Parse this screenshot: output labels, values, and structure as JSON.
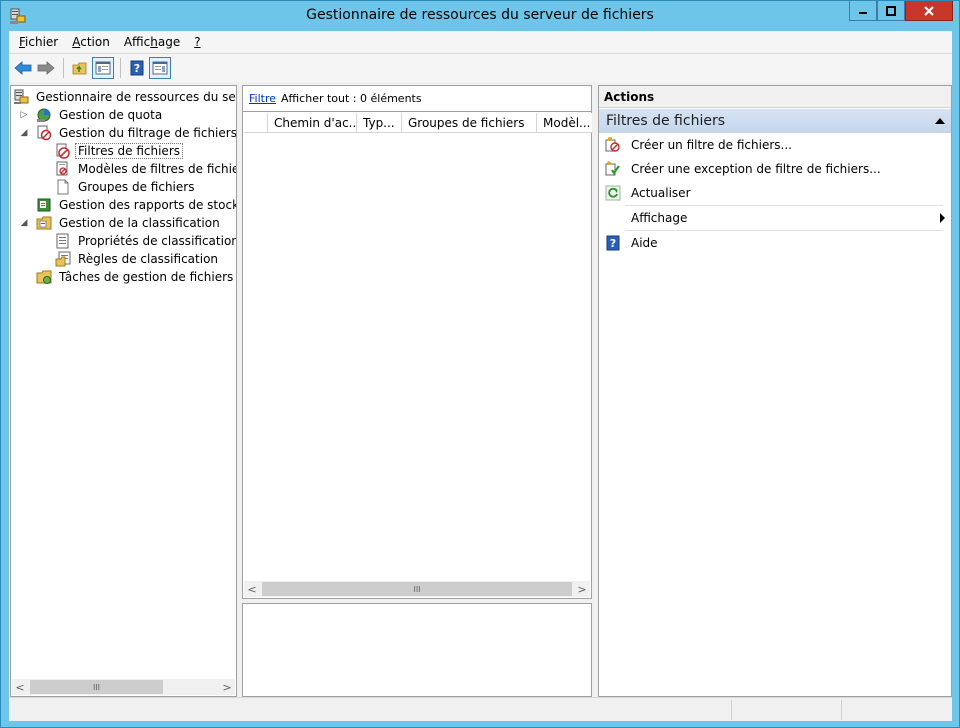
{
  "window": {
    "title": "Gestionnaire de ressources du serveur de fichiers",
    "controls": {
      "minimize": "minimize",
      "maximize": "maximize",
      "close": "close"
    }
  },
  "menu": [
    {
      "label": "Fichier",
      "accel": "F",
      "rest": "ichier"
    },
    {
      "label": "Action",
      "accel": "A",
      "rest": "ction"
    },
    {
      "label": "Affichage",
      "pre": "Affic",
      "accel": "h",
      "rest": "age"
    },
    {
      "label": "?",
      "accel": "?",
      "rest": ""
    }
  ],
  "toolbar": {
    "icons": [
      "back-arrow-icon",
      "forward-arrow-icon",
      "up-folder-icon",
      "show-hide-tree-icon",
      "help-icon",
      "show-hide-actions-icon"
    ]
  },
  "tree": {
    "items": [
      {
        "label": "Gestionnaire de ressources du serveur",
        "level": 0,
        "expander": "",
        "icon": "server-icon"
      },
      {
        "label": "Gestion de quota",
        "level": 1,
        "expander": "▷",
        "icon": "quota-icon"
      },
      {
        "label": "Gestion du filtrage de fichiers",
        "level": 1,
        "expander": "◢",
        "icon": "file-screening-icon"
      },
      {
        "label": "Filtres de fichiers",
        "level": 2,
        "expander": "",
        "icon": "file-screen-icon",
        "selected": true
      },
      {
        "label": "Modèles de filtres de fichiers",
        "level": 2,
        "expander": "",
        "icon": "file-screen-template-icon"
      },
      {
        "label": "Groupes de fichiers",
        "level": 2,
        "expander": "",
        "icon": "file-group-icon"
      },
      {
        "label": "Gestion des rapports de stockage",
        "level": 1,
        "expander": "",
        "icon": "storage-report-icon"
      },
      {
        "label": "Gestion de la classification",
        "level": 1,
        "expander": "◢",
        "icon": "classification-icon"
      },
      {
        "label": "Propriétés de classification",
        "level": 2,
        "expander": "",
        "icon": "classification-property-icon"
      },
      {
        "label": "Règles de classification",
        "level": 2,
        "expander": "",
        "icon": "classification-rule-icon"
      },
      {
        "label": "Tâches de gestion de fichiers",
        "level": 1,
        "expander": "",
        "icon": "file-management-task-icon"
      }
    ],
    "scroll_thumb": "III"
  },
  "center": {
    "filter_link": "Filtre",
    "filter_text": "Afficher tout : 0 éléments",
    "columns": [
      "",
      "Chemin d'ac...",
      "Typ...",
      "Groupes de fichiers",
      "Modèl..."
    ],
    "scroll_thumb": "III"
  },
  "actions": {
    "header": "Actions",
    "section_title": "Filtres de fichiers",
    "items": [
      {
        "label": "Créer un filtre de fichiers...",
        "icon": "create-file-screen-icon"
      },
      {
        "label": "Créer une exception de filtre de fichiers...",
        "icon": "create-exception-icon"
      },
      {
        "label": "Actualiser",
        "icon": "refresh-icon"
      },
      {
        "label": "Affichage",
        "icon": "",
        "submenu": true
      },
      {
        "label": "Aide",
        "icon": "help-icon"
      }
    ]
  },
  "colors": {
    "window_frame": "#6dc6ea",
    "close_button": "#c7352b",
    "section_header": "#c5d6ec",
    "link": "#0033cc"
  }
}
